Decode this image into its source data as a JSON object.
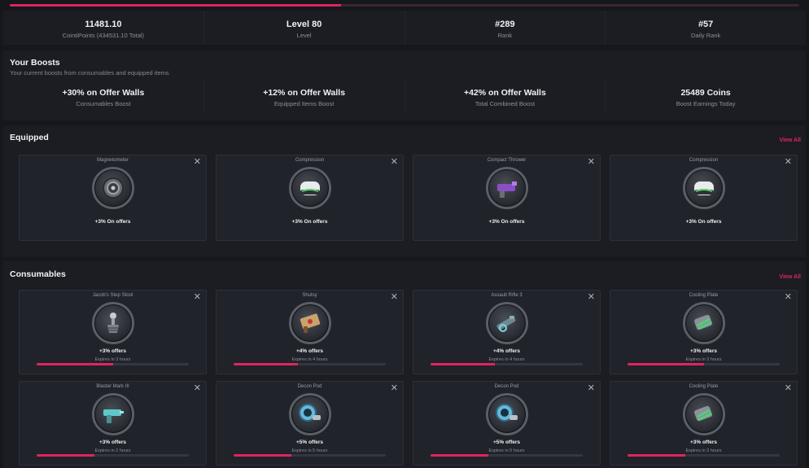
{
  "progress": {
    "level_fraction": 0.42,
    "accent_color": "#e0245e"
  },
  "stats": [
    {
      "value": "11481.10",
      "label": "CointiPoints (434531.10 Total)"
    },
    {
      "value": "Level 80",
      "label": "Level"
    },
    {
      "value": "#289",
      "label": "Rank"
    },
    {
      "value": "#57",
      "label": "Daily Rank"
    }
  ],
  "boosts": {
    "title": "Your Boosts",
    "subtitle": "Your current boosts from consumables and equipped items",
    "items": [
      {
        "value": "+30% on Offer Walls",
        "label": "Consumables Boost"
      },
      {
        "value": "+12% on Offer Walls",
        "label": "Equipped Items Boost"
      },
      {
        "value": "+42% on Offer Walls",
        "label": "Total Combined Boost"
      },
      {
        "value": "25489 Coins",
        "label": "Boost Earnings Today"
      }
    ]
  },
  "equipped": {
    "title": "Equipped",
    "view_all": "View All",
    "items": [
      {
        "name": "Magnetometer",
        "bonus": "+3% On offers",
        "icon": "magnetometer-icon"
      },
      {
        "name": "Compression",
        "bonus": "+3% On offers",
        "icon": "compression-icon"
      },
      {
        "name": "Compact Thrower",
        "bonus": "+3% On offers",
        "icon": "compact-thrower-icon"
      },
      {
        "name": "Compression",
        "bonus": "+3% On offers",
        "icon": "compression-icon"
      }
    ]
  },
  "consumables": {
    "title": "Consumables",
    "view_all": "View All",
    "items": [
      {
        "name": "Jacob's Step Stool",
        "bonus": "+3% offers",
        "expires": "Expires in 3 hours",
        "remaining": 0.5,
        "icon": "step-stool-icon"
      },
      {
        "name": "Shutsy",
        "bonus": "+4% offers",
        "expires": "Expires in 4 hours",
        "remaining": 0.42,
        "icon": "shutsy-icon"
      },
      {
        "name": "Assault Rifle 3",
        "bonus": "+4% offers",
        "expires": "Expires in 4 hours",
        "remaining": 0.42,
        "icon": "assault-rifle-icon"
      },
      {
        "name": "Cooling Plate",
        "bonus": "+3% offers",
        "expires": "Expires in 3 hours",
        "remaining": 0.5,
        "icon": "cooling-plate-icon"
      },
      {
        "name": "Blaster Mark III",
        "bonus": "+3% offers",
        "expires": "Expires in 2 hours",
        "remaining": 0.38,
        "icon": "blaster-icon"
      },
      {
        "name": "Decon Pod",
        "bonus": "+5% offers",
        "expires": "Expires in 5 hours",
        "remaining": 0.38,
        "icon": "decon-pod-icon"
      },
      {
        "name": "Decon Pod",
        "bonus": "+5% offers",
        "expires": "Expires in 5 hours",
        "remaining": 0.38,
        "icon": "decon-pod-icon"
      },
      {
        "name": "Cooling Plate",
        "bonus": "+3% offers",
        "expires": "Expires in 3 hours",
        "remaining": 0.38,
        "icon": "cooling-plate-icon"
      }
    ]
  }
}
